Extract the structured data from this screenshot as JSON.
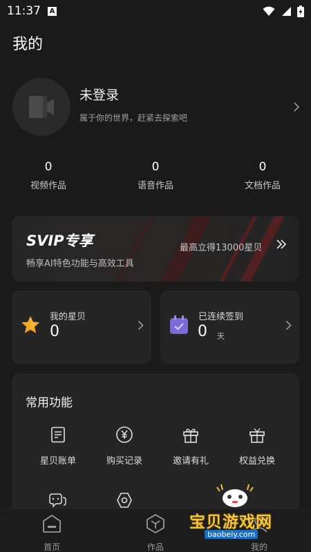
{
  "status_bar": {
    "time": "11:37",
    "notification_glyph": "A"
  },
  "header": {
    "title": "我的"
  },
  "profile": {
    "name": "未登录",
    "subtitle": "属于你的世界，赶紧去探索吧"
  },
  "stats": [
    {
      "value": "0",
      "label": "视频作品"
    },
    {
      "value": "0",
      "label": "语音作品"
    },
    {
      "value": "0",
      "label": "文档作品"
    }
  ],
  "svip": {
    "title": "SVIP专享",
    "subtitle": "畅享AI特色功能与高效工具",
    "reward": "最高立得13000星贝"
  },
  "cards": {
    "stars": {
      "label": "我的星贝",
      "value": "0"
    },
    "checkin": {
      "label": "已连续签到",
      "value": "0",
      "unit": "天"
    }
  },
  "functions": {
    "title": "常用功能",
    "items": [
      {
        "label": "星贝账单",
        "icon": "bill-icon"
      },
      {
        "label": "购买记录",
        "icon": "yen-coin-icon"
      },
      {
        "label": "邀请有礼",
        "icon": "gift-icon"
      },
      {
        "label": "权益兑换",
        "icon": "gift-exchange-icon"
      }
    ],
    "second_row_icons": [
      "chat-bubbles-icon",
      "hexagon-settings-icon"
    ]
  },
  "tabbar": {
    "items": [
      {
        "label": "首页"
      },
      {
        "label": "作品"
      },
      {
        "label": "我的"
      }
    ]
  },
  "watermark": {
    "text": "宝贝游戏网",
    "url": "baobeiy.com"
  },
  "colors": {
    "background": "#1a1a1a",
    "card": "#252525",
    "accent_star": "#f5a623",
    "accent_calendar": "#7a6bd6",
    "svip_stripe": "#8b1e1e",
    "watermark_gold": "#f6c53a"
  }
}
